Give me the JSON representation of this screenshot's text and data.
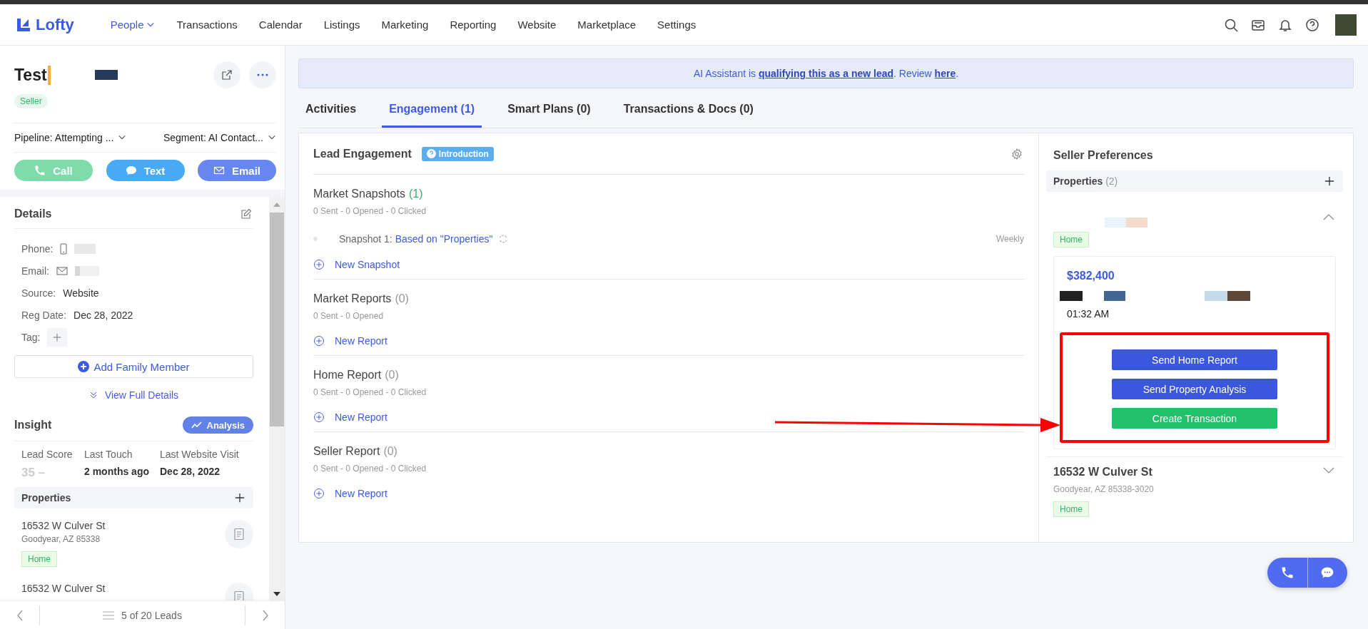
{
  "nav": {
    "logo": "Lofty",
    "items": [
      {
        "label": "People",
        "selected": true,
        "dropdown": true
      },
      {
        "label": "Transactions",
        "selected": false,
        "dropdown": false
      },
      {
        "label": "Calendar",
        "selected": false,
        "dropdown": false
      },
      {
        "label": "Listings",
        "selected": false,
        "dropdown": false
      },
      {
        "label": "Marketing",
        "selected": false,
        "dropdown": false
      },
      {
        "label": "Reporting",
        "selected": false,
        "dropdown": false
      },
      {
        "label": "Website",
        "selected": false,
        "dropdown": false
      },
      {
        "label": "Marketplace",
        "selected": false,
        "dropdown": false
      },
      {
        "label": "Settings",
        "selected": false,
        "dropdown": false
      }
    ]
  },
  "contact": {
    "name": "Test",
    "tag": "Seller",
    "selects": [
      {
        "label": "Pipeline:",
        "value": "Attempting ..."
      },
      {
        "label": "Segment:",
        "value": "AI Contact..."
      }
    ],
    "actions": [
      {
        "kind": "call",
        "label": "Call"
      },
      {
        "kind": "text",
        "label": "Text"
      },
      {
        "kind": "email",
        "label": "Email"
      }
    ]
  },
  "details": {
    "title": "Details",
    "fields": [
      {
        "kind": "phone",
        "label": "Phone:"
      },
      {
        "kind": "email",
        "label": "Email:"
      },
      {
        "kind": "value",
        "label": "Source:",
        "value": "Website"
      },
      {
        "kind": "value",
        "label": "Reg Date:",
        "value": "Dec 28, 2022"
      },
      {
        "kind": "tag",
        "label": "Tag:"
      }
    ],
    "add_family": "Add Family Member",
    "view_full": "View Full Details"
  },
  "insight": {
    "title": "Insight",
    "button": "Analysis",
    "stats": [
      {
        "label": "Lead Score",
        "value": "35 –",
        "muted": true
      },
      {
        "label": "Last Touch",
        "value": "2 months ago",
        "muted": false
      },
      {
        "label": "Last Website Visit",
        "value": "Dec 28, 2022",
        "muted": false
      }
    ]
  },
  "properties": {
    "title": "Properties",
    "items": [
      {
        "address": "16532 W Culver St",
        "city": "Goodyear, AZ 85338",
        "tag": "Home"
      },
      {
        "address": "16532 W Culver St"
      }
    ]
  },
  "pager": {
    "text": "5 of 20 Leads"
  },
  "banner": {
    "lead_in": "AI Assistant is ",
    "link": "qualifying this as a new lead",
    "middle": ". Review ",
    "review_link": "here",
    "end": "."
  },
  "tabs": [
    {
      "label": "Activities",
      "selected": false
    },
    {
      "label": "Engagement (1)",
      "selected": true
    },
    {
      "label": "Smart Plans (0)",
      "selected": false
    },
    {
      "label": "Transactions & Docs (0)",
      "selected": false
    }
  ],
  "engagement": {
    "title": "Lead Engagement",
    "badge": "Introduction",
    "sections": [
      {
        "title": "Market Snapshots",
        "count": "(1)",
        "active": true,
        "stats": "0 Sent - 0 Opened - 0 Clicked",
        "items": [
          {
            "label": "Snapshot 1:",
            "link": "Based on \"Properties\"",
            "frequency": "Weekly"
          }
        ],
        "action": "New Snapshot"
      },
      {
        "title": "Market Reports",
        "count": "(0)",
        "active": false,
        "stats": "0 Sent - 0 Opened",
        "action": "New Report"
      },
      {
        "title": "Home Report",
        "count": "(0)",
        "active": false,
        "stats": "0 Sent - 0 Opened - 0 Clicked",
        "action": "New Report"
      },
      {
        "title": "Seller Report",
        "count": "(0)",
        "active": false,
        "stats": "0 Sent - 0 Opened - 0 Clicked",
        "action": "New Report"
      }
    ]
  },
  "seller": {
    "title": "Seller Preferences",
    "properties_label": "Properties",
    "properties_count": "(2)",
    "items": [
      {
        "expanded": true,
        "tag": "Home",
        "price": "$382,400",
        "time": "01:32 AM",
        "buttons": [
          {
            "kind": "primary",
            "label": "Send Home Report"
          },
          {
            "kind": "primary",
            "label": "Send Property Analysis"
          },
          {
            "kind": "success",
            "label": "Create Transaction"
          }
        ]
      },
      {
        "expanded": false,
        "address": "16532 W Culver St",
        "city": "Goodyear, AZ 85338-3020",
        "tag": "Home"
      }
    ]
  }
}
